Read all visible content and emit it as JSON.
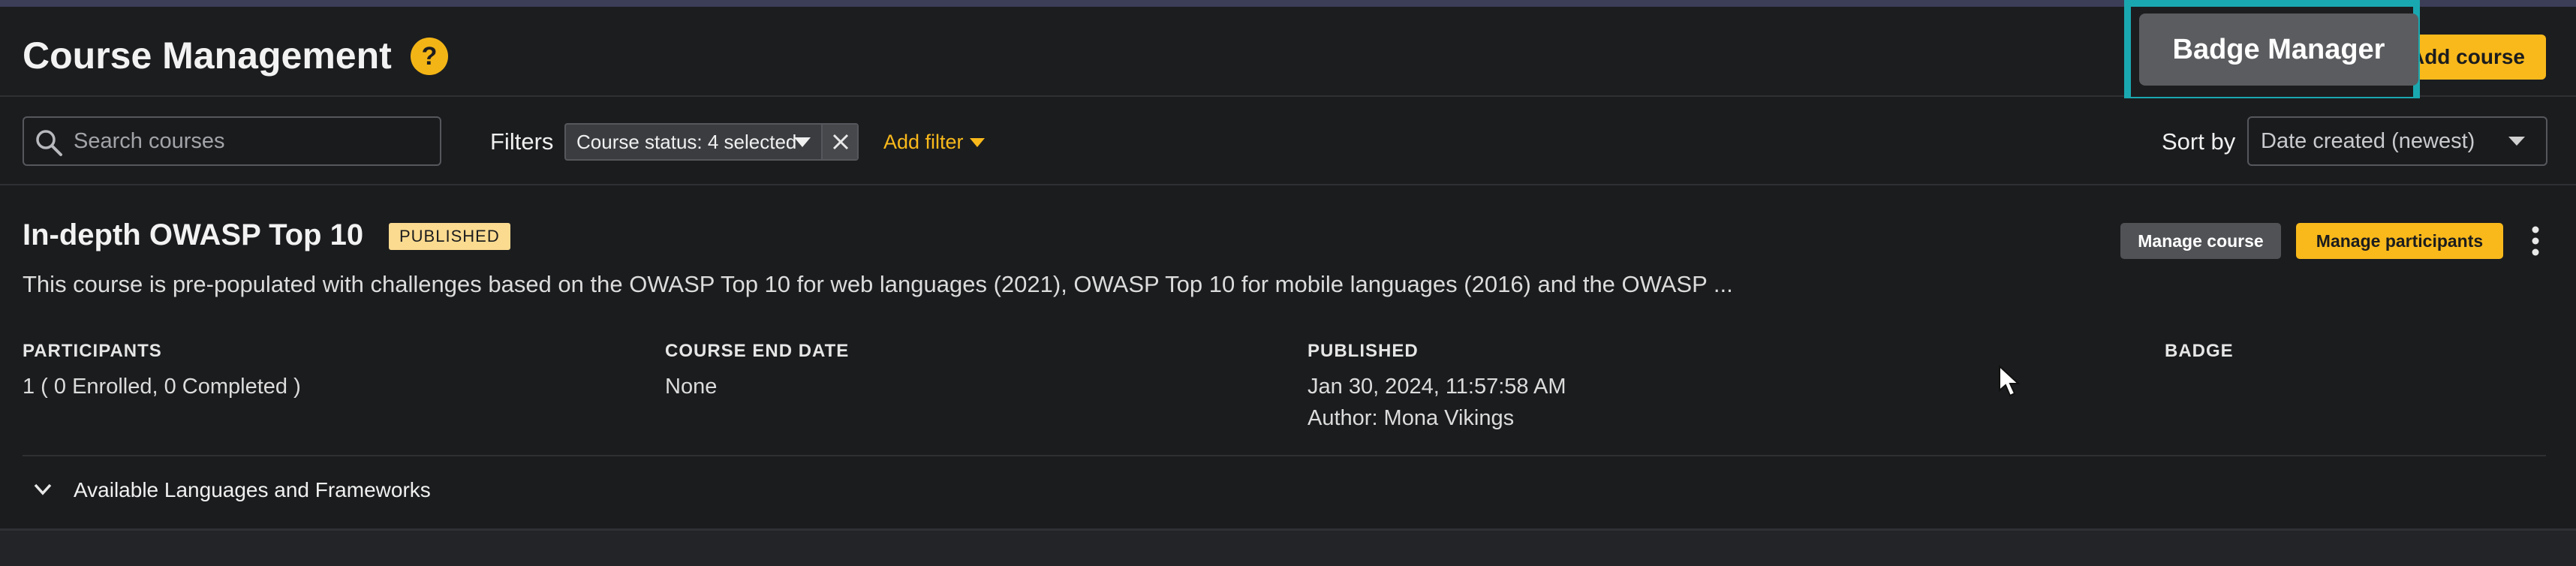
{
  "header": {
    "title": "Course Management",
    "help_icon_glyph": "?",
    "add_course_label": "Add course",
    "badge_manager_label": "Badge Manager"
  },
  "filters": {
    "search_placeholder": "Search courses",
    "filters_label": "Filters",
    "chip_label": "Course status: 4 selected",
    "add_filter_label": "Add filter",
    "sort_label": "Sort by",
    "sort_value": "Date created (newest)"
  },
  "course": {
    "title": "In-depth OWASP Top 10",
    "status": "PUBLISHED",
    "manage_course_label": "Manage course",
    "manage_participants_label": "Manage participants",
    "description": "This course is pre-populated with challenges based on the OWASP Top 10 for web languages (2021), OWASP Top 10 for mobile languages (2016) and the OWASP ...",
    "participants_label": "PARTICIPANTS",
    "participants_value": "1 ( 0 Enrolled, 0 Completed )",
    "end_date_label": "COURSE END DATE",
    "end_date_value": "None",
    "published_label": "PUBLISHED",
    "published_date": "Jan 30, 2024, 11:57:58 AM",
    "published_author": "Author: Mona Vikings",
    "badge_label": "BADGE",
    "expander_label": "Available Languages and Frameworks"
  },
  "colors": {
    "accent": "#f9b91b",
    "highlight": "#1aa8b0",
    "background": "#1b1c1e"
  },
  "icons": {
    "help": "question-circle-icon",
    "search": "search-icon",
    "caret": "caret-down-icon",
    "close": "close-icon",
    "more": "more-vertical-icon",
    "chevron": "chevron-down-icon",
    "cursor": "mouse-pointer-icon"
  }
}
